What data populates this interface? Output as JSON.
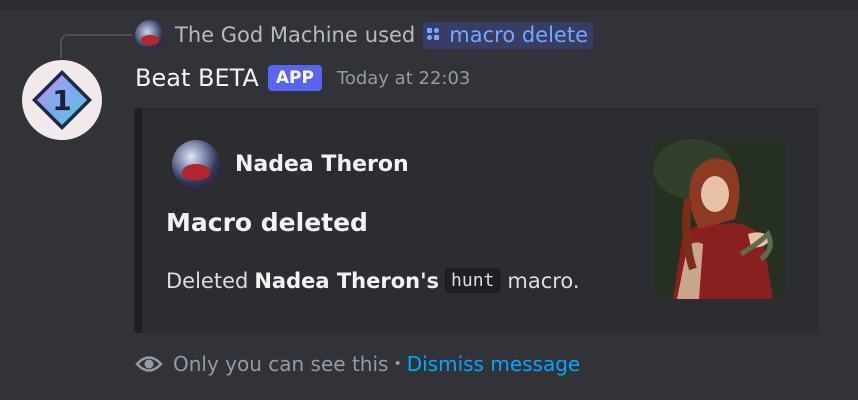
{
  "reply": {
    "invoker_name": "The God Machine",
    "used_text": "used",
    "command": "macro delete",
    "command_icon": "apps-icon"
  },
  "message": {
    "author": "Beat BETA",
    "badge": "APP",
    "timestamp": "Today at 22:03",
    "avatar_icon": "diamond-number-icon",
    "avatar_number": "1"
  },
  "embed": {
    "author_name": "Nadea Theron",
    "title": "Macro deleted",
    "desc_prefix": "Deleted",
    "desc_bold": "Nadea Theron's",
    "desc_code": "hunt",
    "desc_suffix": "macro.",
    "thumbnail": "character-portrait"
  },
  "footer": {
    "text": "Only you can see this",
    "separator": "•",
    "dismiss": "Dismiss message",
    "icon": "eye-icon"
  },
  "colors": {
    "background": "#323339",
    "embed_bg": "#2b2d31",
    "badge": "#5865f2",
    "link": "#00a8fc",
    "command": "#70a9ff"
  }
}
